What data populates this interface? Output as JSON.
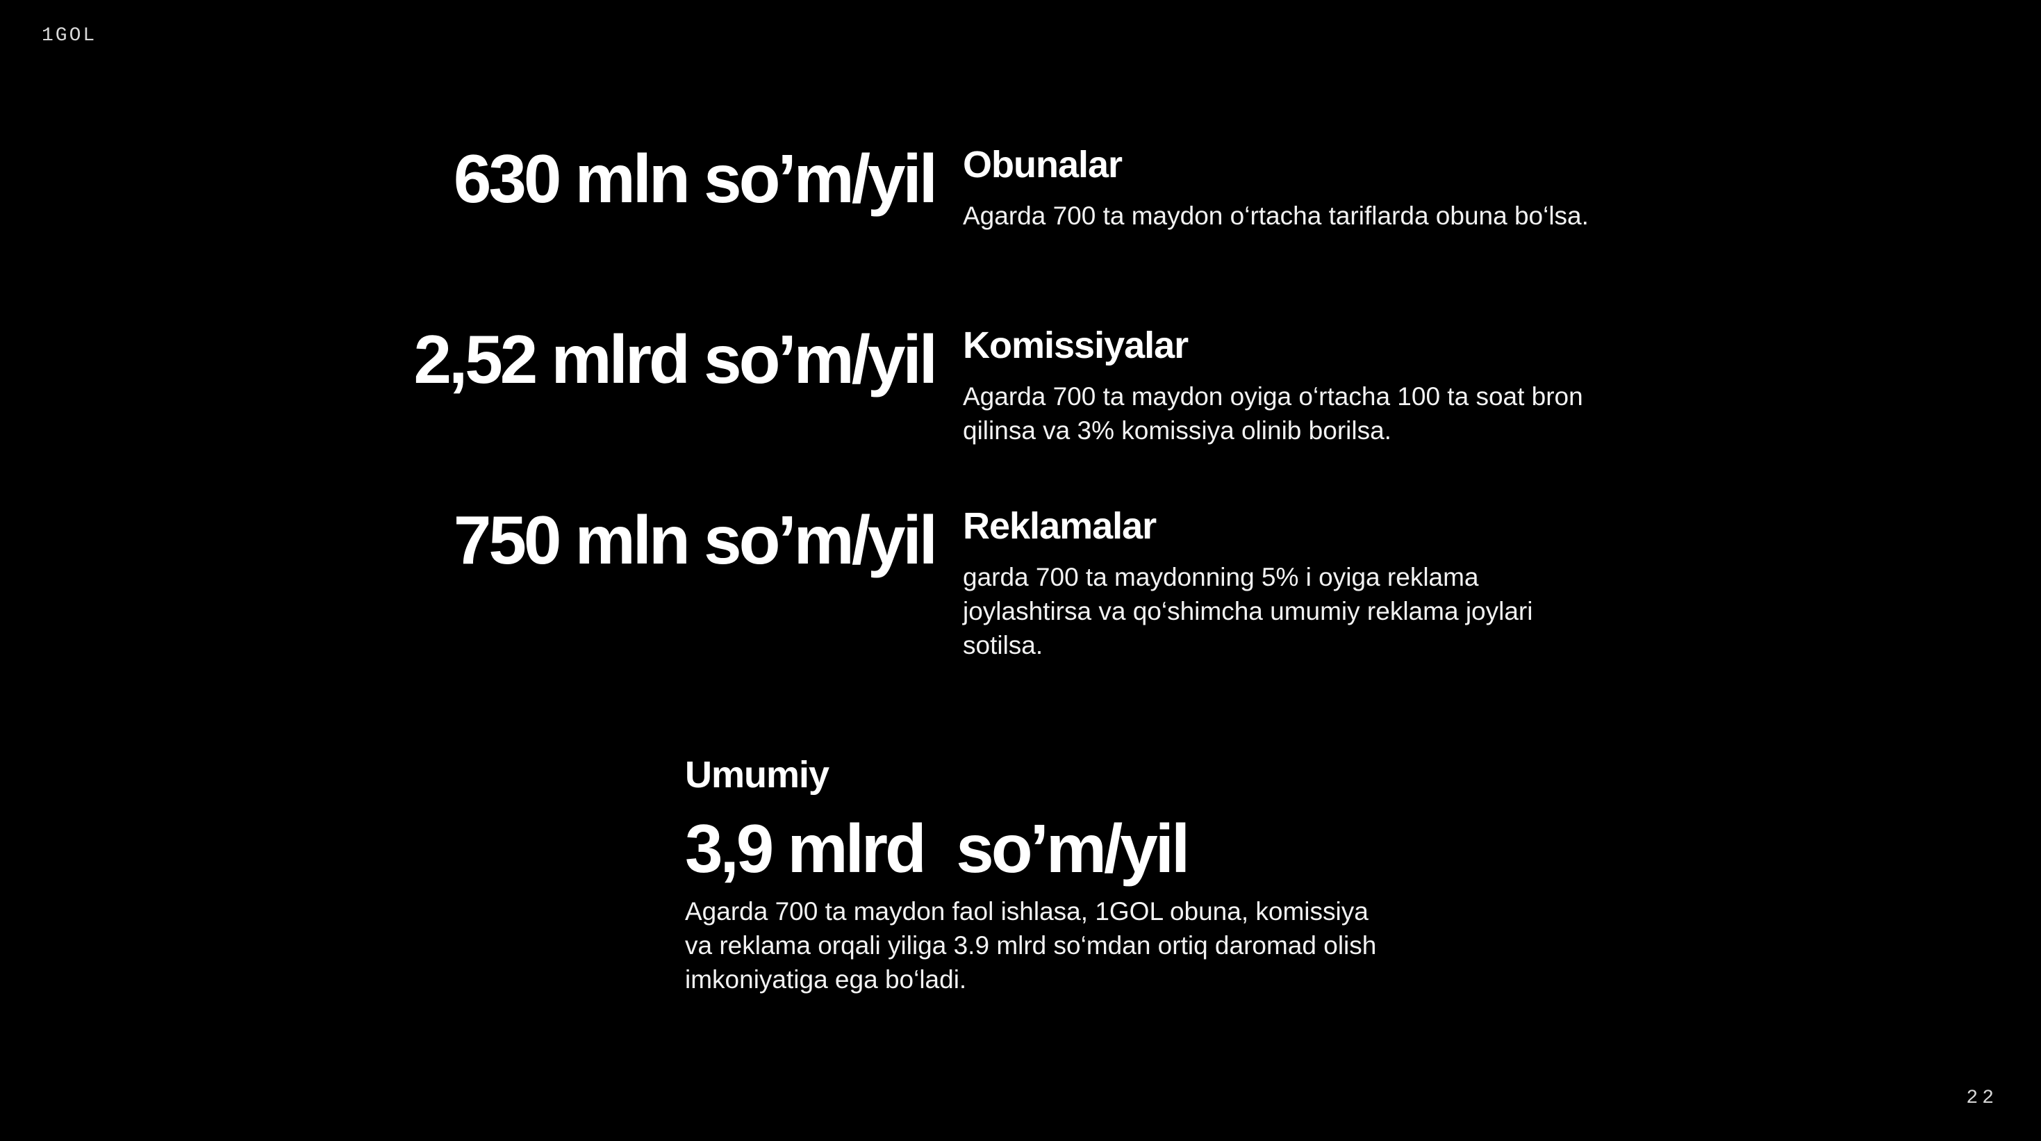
{
  "brand": "1GOL",
  "page_number": "22",
  "items": [
    {
      "amount": "630 mln so’m/yil",
      "title": "Obunalar",
      "description": "Agarda 700 ta maydon o‘rtacha tariflarda obuna bo‘lsa."
    },
    {
      "amount": "2,52 mlrd so’m/yil",
      "title": "Komissiyalar",
      "description": "Agarda 700 ta maydon oyiga o‘rtacha 100 ta soat bron qilinsa va 3% komissiya olinib borilsa."
    },
    {
      "amount": "750 mln so’m/yil",
      "title": "Reklamalar",
      "description": "garda 700 ta maydonning 5% i oyiga reklama joylashtirsa va qo‘shimcha umumiy reklama joylari sotilsa."
    }
  ],
  "total": {
    "label": "Umumiy",
    "amount": "3,9 mlrd  so’m/yil",
    "description": "Agarda 700 ta maydon faol ishlasa, 1GOL obuna, komissiya va reklama orqali yiliga 3.9 mlrd so‘mdan ortiq daromad olish imkoniyatiga ega bo‘ladi."
  }
}
